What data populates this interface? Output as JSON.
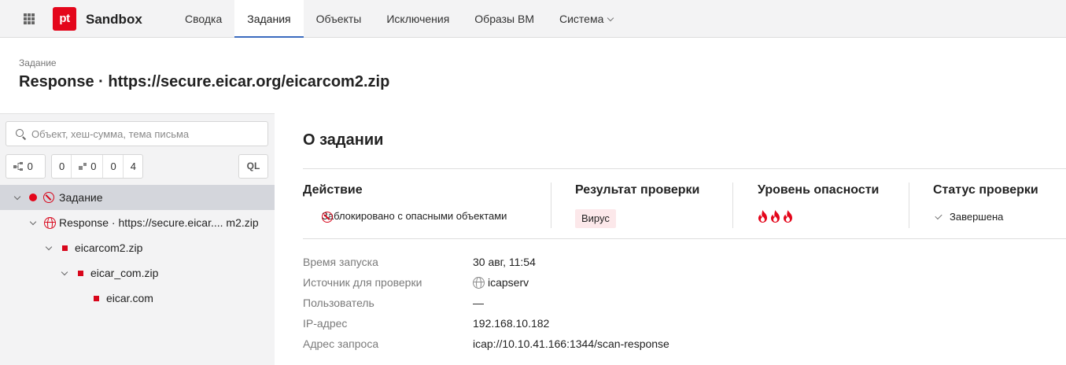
{
  "app": {
    "logo_text": "pt",
    "title": "Sandbox",
    "brand_color": "#e4061b"
  },
  "nav": {
    "items": [
      {
        "label": "Сводка"
      },
      {
        "label": "Задания"
      },
      {
        "label": "Объекты"
      },
      {
        "label": "Исключения"
      },
      {
        "label": "Образы ВМ"
      },
      {
        "label": "Система"
      }
    ],
    "active": "Задания"
  },
  "page": {
    "breadcrumb": "Задание",
    "title": "Response · https://secure.eicar.org/eicarcom2.zip"
  },
  "sidebar": {
    "search_placeholder": "Объект, хеш-сумма, тема письма",
    "filters": {
      "tree_count": "0",
      "gray_count": "0",
      "nodes_count": "0",
      "orange_count": "0",
      "red_count": "4",
      "ql_label": "QL"
    },
    "tree": [
      {
        "label": "Задание",
        "selected": true
      },
      {
        "label": "Response · https://secure.eicar.... m2.zip"
      },
      {
        "label": "eicarcom2.zip"
      },
      {
        "label": "eicar_com.zip"
      },
      {
        "label": "eicar.com"
      }
    ]
  },
  "task": {
    "section_title": "О задании",
    "action": {
      "heading": "Действие",
      "value": "Заблокировано с опасными объектами"
    },
    "result": {
      "heading": "Результат проверки",
      "value": "Вирус"
    },
    "danger": {
      "heading": "Уровень опасности",
      "level": 3,
      "icon": "flame-icon"
    },
    "status": {
      "heading": "Статус проверки",
      "value": "Завершена"
    },
    "details": [
      {
        "label": "Время запуска",
        "value": "30 авг, 11:54"
      },
      {
        "label": "Источник для проверки",
        "value": "icapserv"
      },
      {
        "label": "Пользователь",
        "value": "—"
      },
      {
        "label": "IP-адрес",
        "value": "192.168.10.182"
      },
      {
        "label": "Адрес запроса",
        "value": "icap://10.10.41.166:1344/scan-response"
      }
    ]
  }
}
